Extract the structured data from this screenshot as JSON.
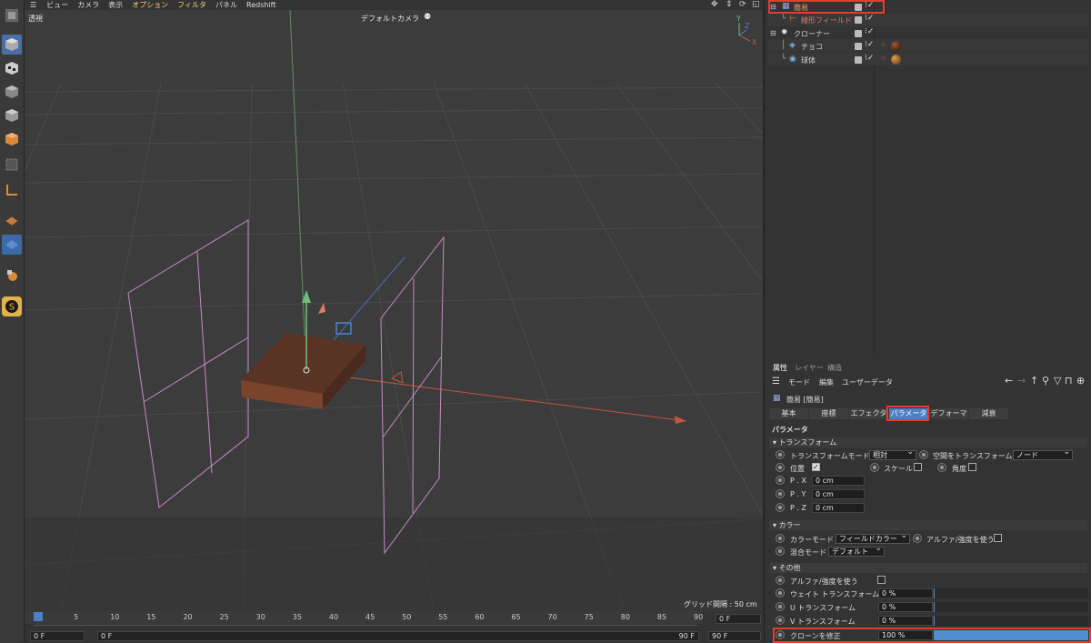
{
  "menu": [
    "ビュー",
    "カメラ",
    "表示",
    "オプション",
    "フィルタ",
    "パネル",
    "Redshift"
  ],
  "viewport": {
    "view_name": "透視",
    "camera_label": "デフォルトカメラ",
    "grid_info": "グリッド間隔 : 50 cm"
  },
  "timeline": {
    "ticks": [
      "0",
      "5",
      "10",
      "15",
      "20",
      "25",
      "30",
      "35",
      "40",
      "45",
      "50",
      "55",
      "60",
      "65",
      "70",
      "75",
      "80",
      "85",
      "90"
    ],
    "current_frame": "0 F",
    "start_field": "0 F",
    "start_field2": "0 F",
    "end_field": "90 F",
    "end_field2": "90 F",
    "end_field3": "90 F"
  },
  "objects": [
    {
      "name": "簡易",
      "color": "#f0a35a"
    },
    {
      "name": "線形フィールド",
      "color": "#d87d6a"
    },
    {
      "name": "クローナー",
      "color": "#e8e8e8"
    },
    {
      "name": "チョコ",
      "color": "#e8e8e8"
    },
    {
      "name": "球体",
      "color": "#e8e8e8"
    }
  ],
  "attr": {
    "tabs": [
      "属性",
      "レイヤー",
      "構造"
    ],
    "menu": [
      "モード",
      "編集",
      "ユーザーデータ"
    ],
    "object_title": "簡易 [簡易]",
    "param_tabs": [
      "基本",
      "座標",
      "エフェクタ",
      "パラメータ",
      "デフォーマ",
      "減衰"
    ],
    "section_title": "パラメータ",
    "transform": {
      "header": "トランスフォーム",
      "mode_label": "トランスフォームモード",
      "mode_value": "相対",
      "space_label": "空間をトランスフォーム",
      "space_value": "ノード",
      "position_label": "位置",
      "scale_label": "スケール",
      "angle_label": "角度",
      "px_label": "P . X",
      "px_value": "0 cm",
      "py_label": "P . Y",
      "py_value": "0 cm",
      "pz_label": "P . Z",
      "pz_value": "0 cm"
    },
    "color": {
      "header": "カラー",
      "mode_label": "カラーモード",
      "mode_value": "フィールドカラー",
      "alpha_label": "アルファ/強度を使う",
      "blend_label": "混合モード",
      "blend_value": "デフォルト"
    },
    "other": {
      "header": "その他",
      "alpha_label": "アルファ/強度を使う",
      "weight_label": "ウェイト トランスフォーム",
      "weight_value": "0 %",
      "u_label": "U トランスフォーム",
      "u_value": "0 %",
      "v_label": "V トランスフォーム",
      "v_value": "0 %",
      "clone_label": "クローンを修正",
      "clone_value": "100 %",
      "clone_fraction": 1.0
    }
  },
  "colors": {
    "accent": "#4d7fc4",
    "highlight": "#e63c2e"
  }
}
